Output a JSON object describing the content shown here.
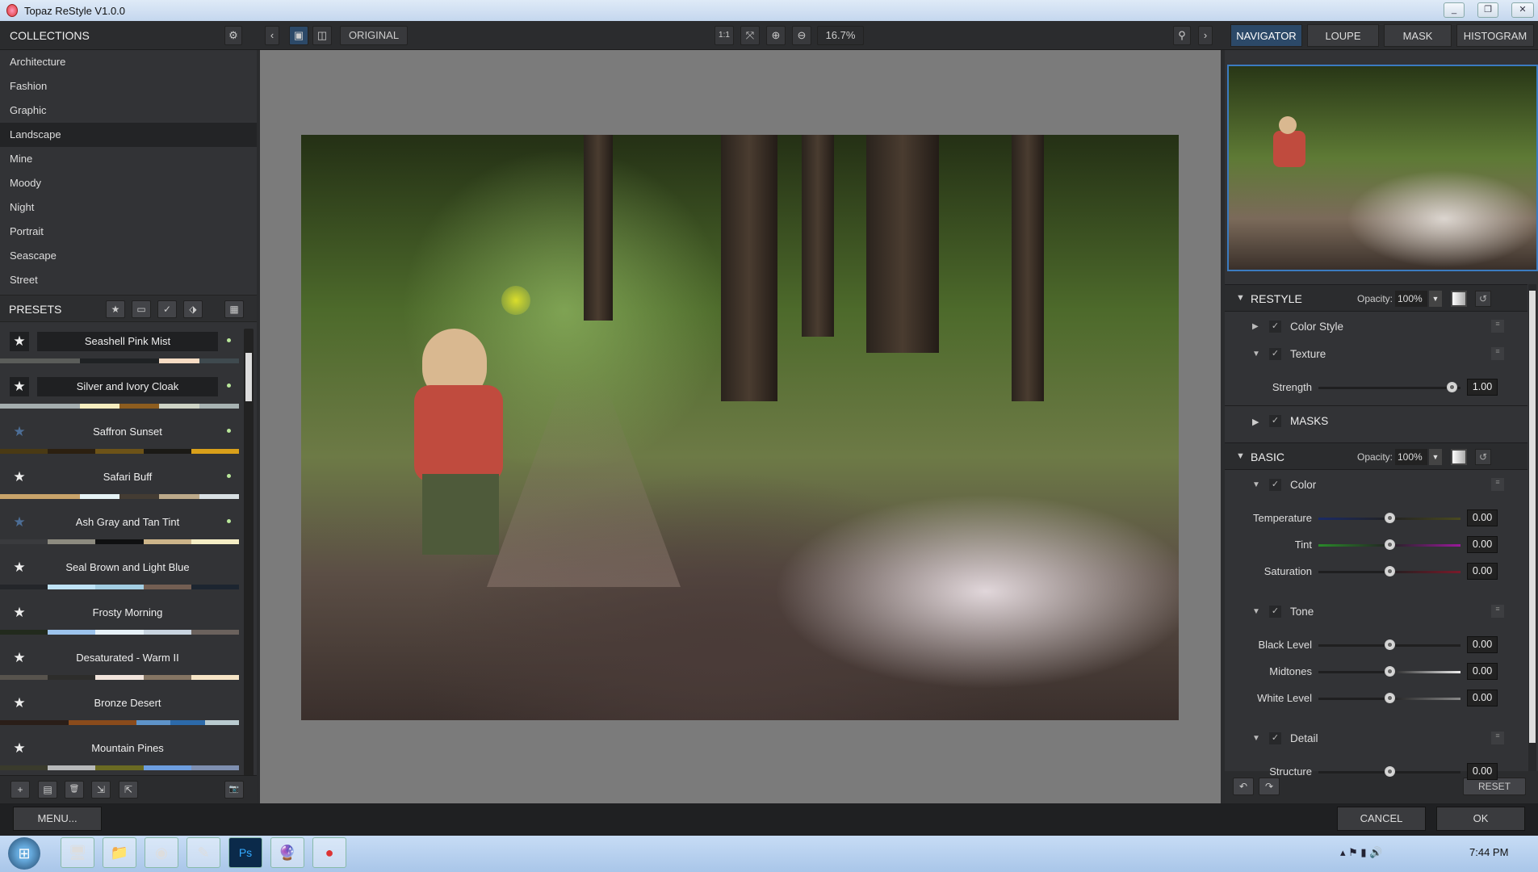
{
  "window": {
    "title": "Topaz ReStyle V1.0.0",
    "minimize": "_",
    "restore": "❐",
    "close": "✕"
  },
  "toolbar": {
    "prev": "‹",
    "original": "ORIGINAL",
    "one_to_one": "1:1",
    "fit": "⤧",
    "zoom_in": "⊕",
    "zoom_out": "⊖",
    "zoom_level": "16.7%",
    "pin": "⚲",
    "next": "›"
  },
  "right_tabs": [
    "NAVIGATOR",
    "LOUPE",
    "MASK",
    "HISTOGRAM"
  ],
  "collections": {
    "title": "COLLECTIONS",
    "items": [
      "Architecture",
      "Fashion",
      "Graphic",
      "Landscape",
      "Mine",
      "Moody",
      "Night",
      "Portrait",
      "Seascape",
      "Street"
    ],
    "selected": "Landscape"
  },
  "presets": {
    "title": "PRESETS",
    "items": [
      {
        "name": "Seashell Pink Mist",
        "star": "★",
        "starred": "white",
        "highlight": true,
        "colors": [
          "#5b5d5a",
          "#5b5d5a",
          "#1f2224",
          "#1f2224",
          "#f7dcc4",
          "#3f4a4f"
        ]
      },
      {
        "name": "Silver and Ivory Cloak",
        "star": "★",
        "starred": "white",
        "highlight": true,
        "colors": [
          "#a5aeaf",
          "#a5aeaf",
          "#f6edbf",
          "#8d5d1f",
          "#cfd4c6",
          "#a8b3b3"
        ]
      },
      {
        "name": "Saffron Sunset",
        "star": "★",
        "starred": "blue",
        "highlight": false,
        "colors": [
          "#4a3a14",
          "#2c2010",
          "#6d5318",
          "#1b1a16",
          "#d9a01a"
        ]
      },
      {
        "name": "Safari Buff",
        "star": "★",
        "starred": "white",
        "highlight": false,
        "colors": [
          "#c8a36a",
          "#c8a36a",
          "#e6f3f6",
          "#443c33",
          "#bca98a",
          "#d9e0e4"
        ]
      },
      {
        "name": "Ash Gray and Tan Tint",
        "star": "★",
        "starred": "blue",
        "highlight": false,
        "colors": [
          "#3a3b3e",
          "#8d8b80",
          "#0f1011",
          "#cdb58a",
          "#f5eec5"
        ]
      },
      {
        "name": "Seal Brown and Light Blue",
        "star": "★",
        "starred": "white",
        "highlight": false,
        "colors": [
          "#24262a",
          "#bfe3f7",
          "#a3cee3",
          "#735e52",
          "#1c2530"
        ]
      },
      {
        "name": "Frosty Morning",
        "star": "★",
        "starred": "white",
        "highlight": false,
        "colors": [
          "#222a1d",
          "#9cc3ec",
          "#e6f1f8",
          "#c8d4e0",
          "#6b625d"
        ]
      },
      {
        "name": "Desaturated - Warm II",
        "star": "★",
        "starred": "white",
        "highlight": false,
        "colors": [
          "#57534d",
          "#2d2d2b",
          "#f1e4dc",
          "#857563",
          "#f6e4c6"
        ]
      },
      {
        "name": "Bronze Desert",
        "star": "★",
        "starred": "white",
        "highlight": false,
        "colors": [
          "#2a1e18",
          "#2a1e18",
          "#8a4b1c",
          "#8a4b1c",
          "#5e93c9",
          "#2c6aaa",
          "#b9cbd0"
        ]
      },
      {
        "name": "Mountain Pines",
        "star": "★",
        "starred": "white",
        "highlight": false,
        "colors": [
          "#3a3b2c",
          "#b7b9ba",
          "#6a6a22",
          "#6d9ee0",
          "#7e8fb0"
        ]
      }
    ]
  },
  "left_bottom": {
    "add": "+",
    "doc": "▤",
    "delete": "🗑",
    "import": "⇲",
    "export": "⇱",
    "camera": "📷"
  },
  "restyle": {
    "title": "RESTYLE",
    "opacity_label": "Opacity:",
    "opacity": "100%",
    "color_style": "Color Style",
    "texture": "Texture",
    "strength_label": "Strength",
    "strength": "1.00",
    "strength_fraction": 0.94,
    "masks": "MASKS"
  },
  "basic": {
    "title": "BASIC",
    "opacity_label": "Opacity:",
    "opacity": "100%",
    "color": {
      "title": "Color",
      "sliders": [
        {
          "label": "Temperature",
          "value": "0.00",
          "fraction": 0.5
        },
        {
          "label": "Tint",
          "value": "0.00",
          "fraction": 0.5
        },
        {
          "label": "Saturation",
          "value": "0.00",
          "fraction": 0.5
        }
      ]
    },
    "tone": {
      "title": "Tone",
      "sliders": [
        {
          "label": "Black Level",
          "value": "0.00",
          "fraction": 0.5
        },
        {
          "label": "Midtones",
          "value": "0.00",
          "fraction": 0.5
        },
        {
          "label": "White Level",
          "value": "0.00",
          "fraction": 0.5
        }
      ]
    },
    "detail": {
      "title": "Detail",
      "sliders": [
        {
          "label": "Structure",
          "value": "0.00",
          "fraction": 0.5
        }
      ]
    }
  },
  "right_bottom": {
    "undo": "↶",
    "redo": "↷",
    "reset": "RESET"
  },
  "bottom": {
    "menu": "MENU...",
    "cancel": "CANCEL",
    "ok": "OK"
  },
  "taskbar": {
    "clock": "7:44 PM",
    "start": "⊞",
    "apps": [
      "🖥",
      "📁",
      "◉",
      "✎",
      "Ps",
      "🔮",
      "●"
    ]
  }
}
